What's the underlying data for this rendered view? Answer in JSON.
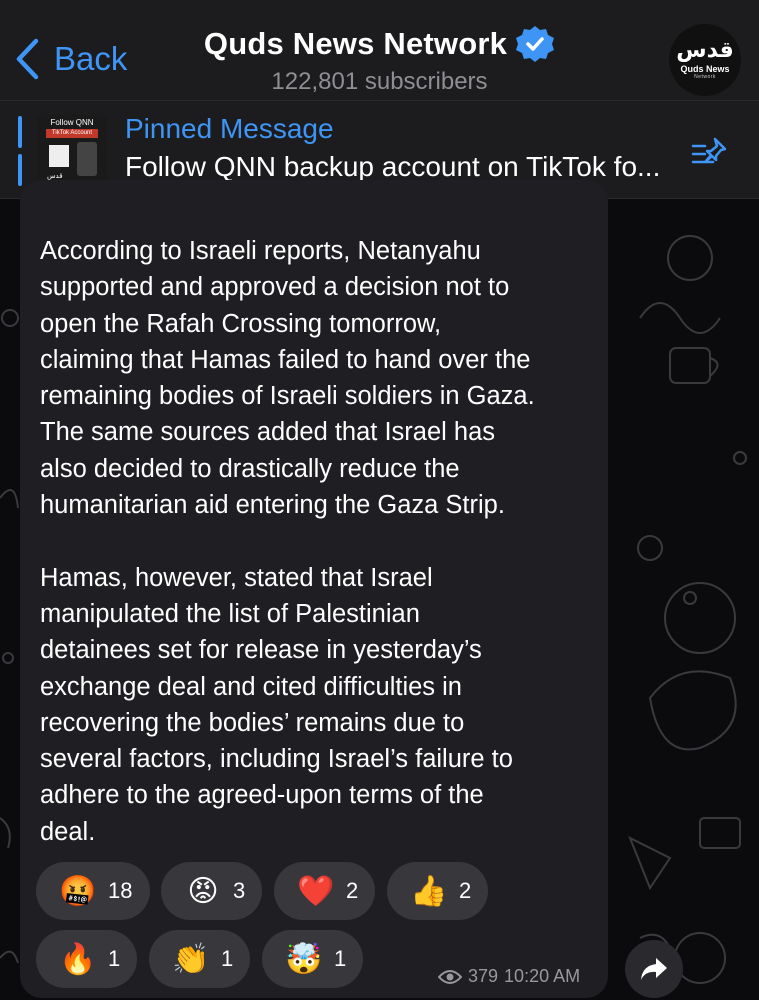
{
  "header": {
    "back_label": "Back",
    "channel_name": "Quds News Network",
    "subscribers": "122,801 subscribers",
    "avatar": {
      "logo_text": "قدس",
      "name": "Quds News",
      "subtitle": "Network"
    }
  },
  "pinned": {
    "title": "Pinned Message",
    "text": "Follow QNN backup account on TikTok fo...",
    "thumbnail": {
      "line1": "Follow QNN",
      "line2": "TikTok Account",
      "logo": "قدس"
    }
  },
  "message": {
    "text": "According to Israeli reports, Netanyahu\nsupported and approved a decision not to\nopen the Rafah Crossing tomorrow,\nclaiming that Hamas failed to hand over the\nremaining bodies of Israeli soldiers in Gaza.\nThe same sources added that Israel has\nalso decided to drastically reduce the\nhumanitarian aid entering the Gaza Strip.\n\nHamas, however, stated that Israel\nmanipulated the list of Palestinian\ndetainees set for release in yesterday’s\nexchange deal and cited difficulties in\nrecovering the bodies’ remains due to\nseveral factors, including Israel’s failure to\nadhere to the agreed-upon terms of the\ndeal.",
    "reactions": [
      {
        "emoji": "🤬",
        "count": "18",
        "icon": "cursing-face-icon"
      },
      {
        "emoji": "😡",
        "count": "3",
        "icon": "angry-face-icon"
      },
      {
        "emoji": "❤️",
        "count": "2",
        "icon": "red-heart-icon"
      },
      {
        "emoji": "👍",
        "count": "2",
        "icon": "thumbs-up-icon"
      },
      {
        "emoji": "🔥",
        "count": "1",
        "icon": "fire-icon"
      },
      {
        "emoji": "👏",
        "count": "1",
        "icon": "clapping-hands-icon"
      },
      {
        "emoji": "🤯",
        "count": "1",
        "icon": "exploding-head-icon"
      }
    ],
    "views": "379",
    "time": "10:20 AM"
  },
  "colors": {
    "accent": "#3e95f5",
    "bubble": "#1f1e23",
    "reaction_bg": "#38373c",
    "header_bg": "#1c1c1e"
  }
}
